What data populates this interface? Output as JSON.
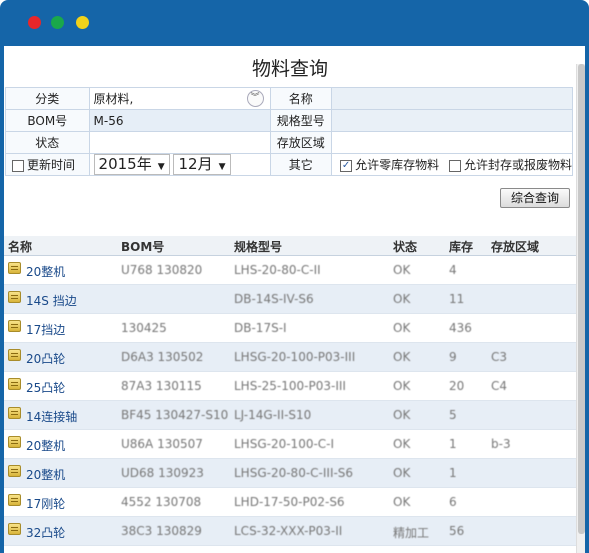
{
  "page": {
    "title": "物料查询"
  },
  "form": {
    "category_label": "分类",
    "category_value": "原材料,",
    "name_label": "名称",
    "bom_label": "BOM号",
    "bom_value": "M-56",
    "spec_label": "规格型号",
    "status_label": "状态",
    "location_label": "存放区域",
    "update_time_label": "更新时间",
    "year_value": "2015年",
    "month_value": "12月",
    "other_label": "其它",
    "allow_zero_label": "允许零库存物料",
    "allow_zero_checked": true,
    "allow_sealed_label": "允许封存或报废物料",
    "allow_sealed_checked": false,
    "query_button": "综合查询"
  },
  "grid": {
    "columns": [
      "名称",
      "BOM号",
      "规格型号",
      "状态",
      "库存",
      "存放区域"
    ],
    "rows": [
      {
        "name": "20整机",
        "bom": "U768 130820",
        "spec": "LHS-20-80-C-II",
        "status": "OK",
        "stock": "4",
        "loc": ""
      },
      {
        "name": "14S 挡边",
        "bom": "",
        "spec": "DB-14S-IV-S6",
        "status": "OK",
        "stock": "11",
        "loc": ""
      },
      {
        "name": "17挡边",
        "bom": "130425",
        "spec": "DB-17S-I",
        "status": "OK",
        "stock": "436",
        "loc": ""
      },
      {
        "name": "20凸轮",
        "bom": "D6A3 130502",
        "spec": "LHSG-20-100-P03-III",
        "status": "OK",
        "stock": "9",
        "loc": "C3"
      },
      {
        "name": "25凸轮",
        "bom": "87A3 130115",
        "spec": "LHS-25-100-P03-III",
        "status": "OK",
        "stock": "20",
        "loc": "C4"
      },
      {
        "name": "14连接轴",
        "bom": "BF45 130427-S10",
        "spec": "LJ-14G-II-S10",
        "status": "OK",
        "stock": "5",
        "loc": ""
      },
      {
        "name": "20整机",
        "bom": "U86A 130507",
        "spec": "LHSG-20-100-C-I",
        "status": "OK",
        "stock": "1",
        "loc": "b-3"
      },
      {
        "name": "20整机",
        "bom": "UD68 130923",
        "spec": "LHSG-20-80-C-III-S6",
        "status": "OK",
        "stock": "1",
        "loc": ""
      },
      {
        "name": "17刚轮",
        "bom": "4552 130708",
        "spec": "LHD-17-50-P02-S6",
        "status": "OK",
        "stock": "6",
        "loc": ""
      },
      {
        "name": "32凸轮",
        "bom": "38C3 130829",
        "spec": "LCS-32-XXX-P03-II",
        "status": "精加工",
        "stock": "56",
        "loc": ""
      }
    ]
  },
  "colors": {
    "window_frame": "#1565a8",
    "link": "#1a4a8a"
  }
}
